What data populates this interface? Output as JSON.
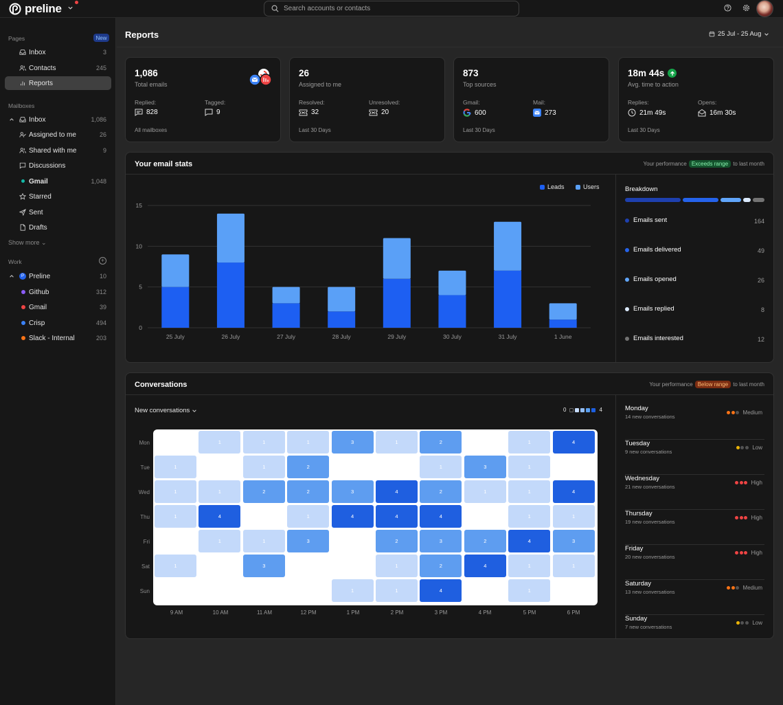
{
  "app": {
    "brand": "preline",
    "search_placeholder": "Search accounts or contacts"
  },
  "colors": {
    "leads": "#1d5ff2",
    "users": "#5aa0f7",
    "green": "#16a34a"
  },
  "sidebar": {
    "pages_label": "Pages",
    "new_badge": "New",
    "pages": [
      {
        "label": "Inbox",
        "count": "3",
        "icon": "inbox-icon"
      },
      {
        "label": "Contacts",
        "count": "245",
        "icon": "users-icon"
      },
      {
        "label": "Reports",
        "count": "",
        "icon": "chart-icon"
      }
    ],
    "mailboxes_label": "Mailboxes",
    "mailboxes": [
      {
        "label": "Inbox",
        "count": "1,086",
        "icon": "inbox-icon"
      },
      {
        "label": "Assigned to me",
        "count": "26",
        "icon": "user-check-icon"
      },
      {
        "label": "Shared with me",
        "count": "9",
        "icon": "users-icon"
      },
      {
        "label": "Discussions",
        "count": "",
        "icon": "message-icon"
      },
      {
        "label": "Gmail",
        "count": "1,048",
        "icon": "dot"
      },
      {
        "label": "Starred",
        "count": "",
        "icon": "star-icon"
      },
      {
        "label": "Sent",
        "count": "",
        "icon": "send-icon"
      },
      {
        "label": "Drafts",
        "count": "",
        "icon": "file-icon"
      }
    ],
    "show_more": "Show more",
    "work_label": "Work",
    "work": [
      {
        "label": "Preline",
        "count": "10",
        "color": "#2563eb"
      },
      {
        "label": "Github",
        "count": "312",
        "color": "#8b5cf6"
      },
      {
        "label": "Gmail",
        "count": "39",
        "color": "#ef4444"
      },
      {
        "label": "Crisp",
        "count": "494",
        "color": "#3b82f6"
      },
      {
        "label": "Slack - Internal",
        "count": "203",
        "color": "#f97316"
      }
    ]
  },
  "header": {
    "title": "Reports",
    "date_range": "25 Jul - 25 Aug"
  },
  "stats": [
    {
      "value": "1,086",
      "label": "Total emails",
      "k1": "Replied:",
      "v1": "828",
      "k2": "Tagged:",
      "v2": "9",
      "foot": "All mailboxes"
    },
    {
      "value": "26",
      "label": "Assigned to me",
      "k1": "Resolved:",
      "v1": "32",
      "k2": "Unresolved:",
      "v2": "20",
      "foot": "Last 30 Days"
    },
    {
      "value": "873",
      "label": "Top sources",
      "k1": "Gmail:",
      "v1": "600",
      "k2": "Mail:",
      "v2": "273",
      "foot": "Last 30 Days"
    },
    {
      "value": "18m 44s",
      "label": "Avg. time to action",
      "k1": "Replies:",
      "v1": "21m 49s",
      "k2": "Opens:",
      "v2": "16m 30s",
      "foot": "Last 30 Days"
    }
  ],
  "email_stats": {
    "title": "Your email stats",
    "perf_prefix": "Your performance",
    "perf_badge": "Exceeds range",
    "perf_suffix": "to last month",
    "breakdown_title": "Breakdown",
    "breakdown": [
      {
        "label": "Emails sent",
        "count": "164",
        "color": "#1e40af"
      },
      {
        "label": "Emails delivered",
        "count": "49",
        "color": "#2563eb"
      },
      {
        "label": "Emails opened",
        "count": "26",
        "color": "#60a5fa"
      },
      {
        "label": "Emails replied",
        "count": "8",
        "color": "#dbeafe"
      },
      {
        "label": "Emails interested",
        "count": "12",
        "color": "#737373"
      }
    ]
  },
  "chart_data": {
    "type": "bar",
    "stacked": true,
    "categories": [
      "25 July",
      "26 July",
      "27 July",
      "28 July",
      "29 July",
      "30 July",
      "31 July",
      "1 June"
    ],
    "series": [
      {
        "name": "Leads",
        "values": [
          5,
          8,
          3,
          2,
          6,
          4,
          7,
          1
        ]
      },
      {
        "name": "Users",
        "values": [
          4,
          6,
          2,
          3,
          5,
          3,
          6,
          2
        ]
      }
    ],
    "yticks": [
      0,
      5,
      10,
      15
    ],
    "ylim": [
      0,
      15
    ],
    "grid": true,
    "legend": "top-right"
  },
  "conversations": {
    "title": "Conversations",
    "perf_prefix": "Your performance",
    "perf_badge": "Below range",
    "perf_suffix": "to last month",
    "selector": "New conversations",
    "scale_min": "0",
    "scale_max": "4",
    "days": [
      "Mon",
      "Tue",
      "Wed",
      "Thu",
      "Fri",
      "Sat",
      "Sun"
    ],
    "hours": [
      "9 AM",
      "10 AM",
      "11 AM",
      "12 PM",
      "1 PM",
      "2 PM",
      "3 PM",
      "4 PM",
      "5 PM",
      "6 PM"
    ],
    "grid": [
      [
        0,
        1,
        1,
        1,
        3,
        1,
        2,
        0,
        1,
        4
      ],
      [
        1,
        0,
        1,
        2,
        0,
        0,
        1,
        3,
        1,
        0
      ],
      [
        1,
        1,
        2,
        2,
        3,
        4,
        2,
        1,
        1,
        4
      ],
      [
        1,
        4,
        0,
        1,
        4,
        4,
        4,
        0,
        1,
        1
      ],
      [
        0,
        1,
        1,
        3,
        0,
        2,
        3,
        2,
        4,
        3
      ],
      [
        1,
        0,
        3,
        0,
        0,
        1,
        2,
        4,
        1,
        1
      ],
      [
        0,
        0,
        0,
        0,
        1,
        1,
        4,
        0,
        1,
        0
      ]
    ],
    "summary": [
      {
        "day": "Monday",
        "sub": "14 new conversations",
        "level": "Medium"
      },
      {
        "day": "Tuesday",
        "sub": "9 new conversations",
        "level": "Low"
      },
      {
        "day": "Wednesday",
        "sub": "21 new conversations",
        "level": "High"
      },
      {
        "day": "Thursday",
        "sub": "19 new conversations",
        "level": "High"
      },
      {
        "day": "Friday",
        "sub": "20 new conversations",
        "level": "High"
      },
      {
        "day": "Saturday",
        "sub": "13 new conversations",
        "level": "Medium"
      },
      {
        "day": "Sunday",
        "sub": "7 new conversations",
        "level": "Low"
      }
    ]
  }
}
